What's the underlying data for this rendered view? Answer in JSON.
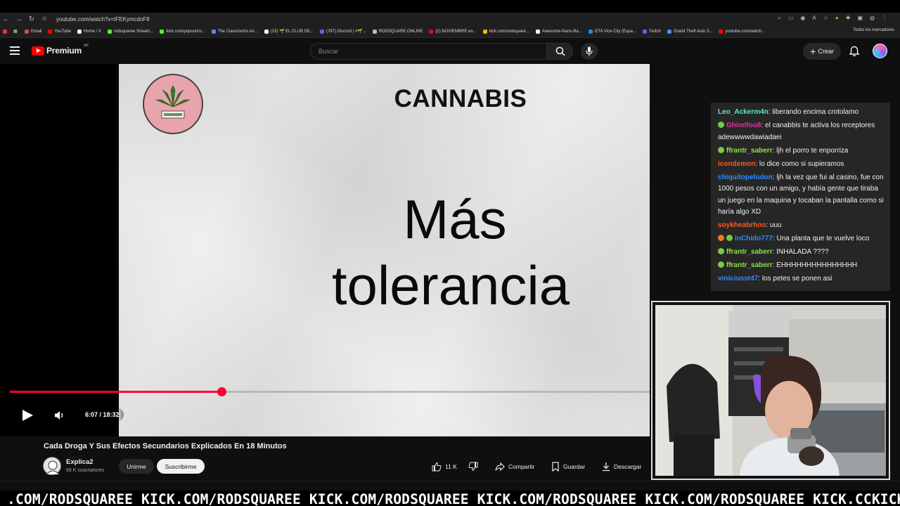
{
  "browser": {
    "url": "youtube.com/watch?v=tFEKymcdoF8",
    "bookmarks": [
      {
        "label": "Gmail",
        "color": "#ea4335"
      },
      {
        "label": "YouTube",
        "color": "#ff0000"
      },
      {
        "label": "Home / X",
        "color": "#ffffff"
      },
      {
        "label": "rodsquaree Stream...",
        "color": "#53fc18"
      },
      {
        "label": "kick.com/popout/ro...",
        "color": "#53fc18"
      },
      {
        "label": "The Classrooms en...",
        "color": "#4e8cff"
      },
      {
        "label": "(13) 🌱 EL CLUB DE...",
        "color": "#ffffff"
      },
      {
        "label": "(787) Discord | #🌱...",
        "color": "#5865f2"
      },
      {
        "label": "RODSQUARE.ONLINE",
        "color": "#bbbbbb"
      },
      {
        "label": "(2) NOVIEMBRE en...",
        "color": "#ff0000"
      },
      {
        "label": "kick.com/rodsquare...",
        "color": "#f4b400"
      },
      {
        "label": "Awesome-Nano-Ba...",
        "color": "#ffffff"
      },
      {
        "label": "GTA Vice City (Espa...",
        "color": "#1e88e5"
      },
      {
        "label": "Twitch",
        "color": "#9146ff"
      },
      {
        "label": "Grand Theft Auto 3...",
        "color": "#4e8cff"
      },
      {
        "label": "youtube.com/watch...",
        "color": "#ff0000"
      }
    ],
    "all_bookmarks": "Todos los marcadores"
  },
  "header": {
    "logo_text": "Premium",
    "country": "AR",
    "search_placeholder": "Buscar",
    "create_label": "Crear"
  },
  "slide": {
    "title": "CANNABIS",
    "line1": "Más",
    "line2": "tolerancia"
  },
  "player": {
    "time": "6:07 / 18:32",
    "progress_fraction": 0.331
  },
  "chat": [
    {
      "user": "Leo_Ackerm4n",
      "color": "#5ee6c8",
      "badge": "",
      "text": "liberando encima crotolamo"
    },
    {
      "user": "GhimIfou8",
      "color": "#e0309a",
      "badge": "green",
      "text": "el canabbis te activa los receptores adewwwwdawiadaei"
    },
    {
      "user": "ffrantr_saberr",
      "color": "#8fe04a",
      "badge": "green",
      "text": "ljh el porro te enporriza"
    },
    {
      "user": "icondemon",
      "color": "#ff5a1e",
      "badge": "",
      "text": "lo dice como si supieramos"
    },
    {
      "user": "chiquitopeludon",
      "color": "#2f8cff",
      "badge": "",
      "text": "ljh la vez que fui al casino, fue con 1000 pesos con un amigo, y había gente que tiraba un juego en la maquina y tocaban la pantalla como si haría algo XD"
    },
    {
      "user": "soykheabrhoo",
      "color": "#ff5a1e",
      "badge": "",
      "text": "uuu"
    },
    {
      "user": "inChido777",
      "color": "#2f8cff",
      "badge": "both",
      "text": "Una planta que te vuelve loco"
    },
    {
      "user": "ffrantr_saberr",
      "color": "#8fe04a",
      "badge": "green",
      "text": "INHALADA ????"
    },
    {
      "user": "ffrantr_saberr",
      "color": "#8fe04a",
      "badge": "green",
      "text": "EHHHHHHHHHHHHHHH"
    },
    {
      "user": "viniciusst47",
      "color": "#2f8cff",
      "badge": "",
      "text": "los petes se ponen asi"
    }
  ],
  "video": {
    "title": "Cada Droga Y Sus Efectos Secundarios Explicados En 18 Minutos",
    "channel": "Explica2",
    "subscribers": "69 K suscriptores",
    "join_label": "Unirme",
    "subscribe_label": "Suscribirme",
    "likes": "11 K",
    "share_label": "Compartir",
    "save_label": "Guardar",
    "download_label": "Descargar"
  },
  "ticker": {
    "text": ".COM/RODSQUAREE KICK.COM/RODSQUAREE KICK.COM/RODSQUAREE KICK.COM/RODSQUAREE KICK.COM/RODSQUAREE KICK.CCKICK"
  },
  "colors": {
    "accent_red": "#ff0033",
    "background": "#0f0f0f"
  }
}
